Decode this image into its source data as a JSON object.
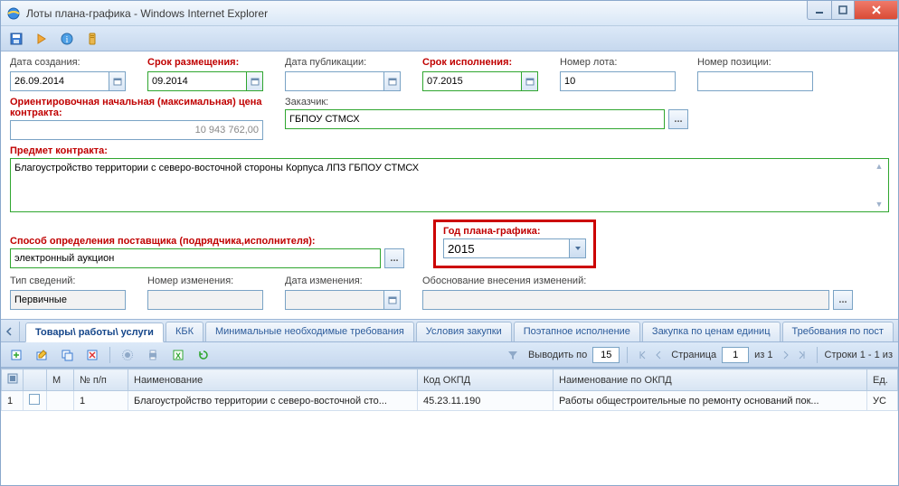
{
  "window": {
    "title": "Лоты плана-графика - Windows Internet Explorer"
  },
  "labels": {
    "creation_date": "Дата создания:",
    "placement_term": "Срок размещения:",
    "publication_date": "Дата публикации:",
    "execution_term": "Срок исполнения:",
    "lot_number": "Номер лота:",
    "position_number": "Номер позиции:",
    "start_price": "Ориентировочная начальная (максимальная) цена контракта:",
    "customer": "Заказчик:",
    "subject": "Предмет контракта:",
    "supplier_method": "Способ определения поставщика (подрядчика,исполнителя):",
    "plan_year": "Год плана-графика:",
    "info_type": "Тип сведений:",
    "change_number": "Номер изменения:",
    "change_date": "Дата изменения:",
    "change_reason": "Обоснование внесения изменений:"
  },
  "values": {
    "creation_date": "26.09.2014",
    "placement_term": "09.2014",
    "publication_date": "",
    "execution_term": "07.2015",
    "lot_number": "10",
    "position_number": "",
    "start_price": "10 943 762,00",
    "customer": "ГБПОУ СТМСХ",
    "subject": "Благоустройство территории с северо-восточной стороны Корпуса ЛПЗ ГБПОУ СТМСХ",
    "supplier_method": "электронный аукцион",
    "plan_year": "2015",
    "info_type": "Первичные",
    "change_number": "",
    "change_date": "",
    "change_reason": ""
  },
  "tabs": [
    "Товары\\ работы\\ услуги",
    "КБК",
    "Минимальные необходимые требования",
    "Условия закупки",
    "Поэтапное исполнение",
    "Закупка по ценам единиц",
    "Требования по пост"
  ],
  "grid_toolbar": {
    "show_per": "Выводить по",
    "per_value": "15",
    "page_label_pre": "Страница",
    "page_value": "1",
    "page_label_post": "из 1",
    "rows_info": "Строки 1 - 1 из"
  },
  "grid": {
    "columns": [
      "",
      "М",
      "№ п/п",
      "Наименование",
      "Код ОКПД",
      "Наименование по ОКПД",
      "Ед."
    ],
    "rows": [
      {
        "num": "1",
        "m": false,
        "npp": "1",
        "name": "Благоустройство территории с северо-восточной сто...",
        "okpd_code": "45.23.11.190",
        "okpd_name": "Работы общестроительные по ремонту оснований пок...",
        "unit": "УС"
      }
    ]
  }
}
